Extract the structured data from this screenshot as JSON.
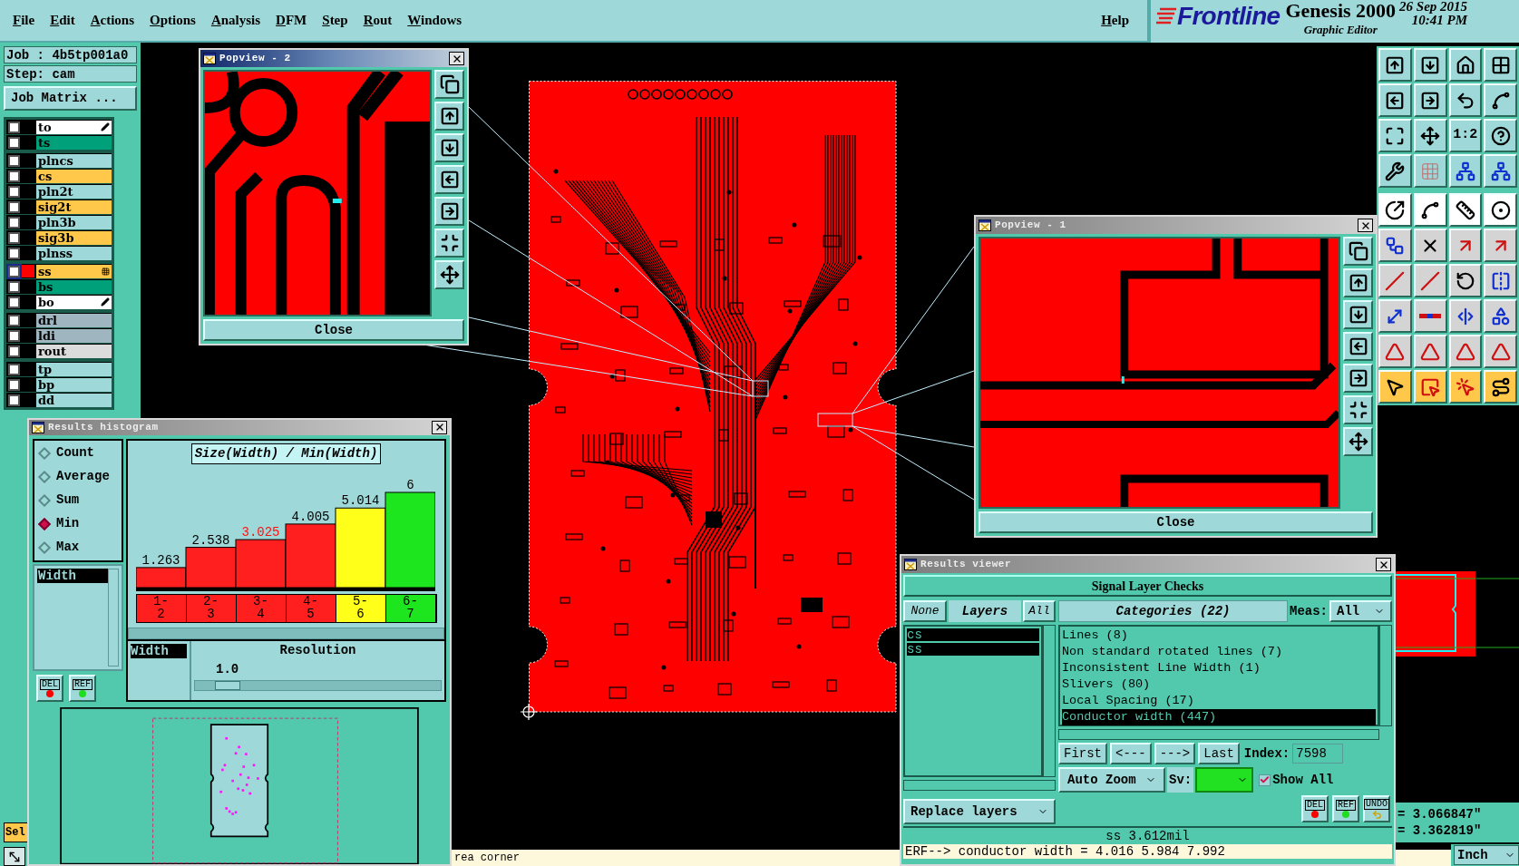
{
  "menu_bar": {
    "items": [
      "File",
      "Edit",
      "Actions",
      "Options",
      "Analysis",
      "DFM",
      "Step",
      "Rout",
      "Windows"
    ],
    "help": "Help"
  },
  "branding": {
    "logo": "Frontline",
    "product": "Genesis 2000",
    "subtitle": "Graphic Editor",
    "date": "26 Sep 2015",
    "time": "10:41 PM"
  },
  "job_panel": {
    "job": "Job : 4b5tp001a0",
    "step": "Step: cam",
    "job_matrix_button": "Job Matrix ...",
    "layer_groups": [
      {
        "layers": [
          {
            "name": "to",
            "color": "#ffffff",
            "checked": false,
            "work_layer": false,
            "pen_mark": true,
            "grid_mark": false
          },
          {
            "name": "ts",
            "color": "#00a07a",
            "checked": false,
            "work_layer": false,
            "pen_mark": false,
            "grid_mark": false
          }
        ]
      },
      {
        "layers": [
          {
            "name": "plncs",
            "color": "#9ed8d8",
            "checked": false,
            "work_layer": false,
            "pen_mark": false,
            "grid_mark": false
          },
          {
            "name": "cs",
            "color": "#ffc84a",
            "checked": false,
            "work_layer": false,
            "pen_mark": false,
            "grid_mark": false
          },
          {
            "name": "pln2t",
            "color": "#9ed8d8",
            "checked": false,
            "work_layer": false,
            "pen_mark": false,
            "grid_mark": false
          },
          {
            "name": "sig2t",
            "color": "#ffc84a",
            "checked": false,
            "work_layer": false,
            "pen_mark": false,
            "grid_mark": false
          },
          {
            "name": "pln3b",
            "color": "#9ed8d8",
            "checked": false,
            "work_layer": false,
            "pen_mark": false,
            "grid_mark": false
          },
          {
            "name": "sig3b",
            "color": "#ffc84a",
            "checked": false,
            "work_layer": false,
            "pen_mark": false,
            "grid_mark": false
          },
          {
            "name": "plnss",
            "color": "#9ed8d8",
            "checked": false,
            "work_layer": false,
            "pen_mark": false,
            "grid_mark": false
          }
        ]
      },
      {
        "layers": [
          {
            "name": "ss",
            "color": "#ffc84a",
            "checked": false,
            "work_layer": true,
            "pen_mark": false,
            "grid_mark": true
          },
          {
            "name": "bs",
            "color": "#00a07a",
            "checked": false,
            "work_layer": false,
            "pen_mark": false,
            "grid_mark": false
          },
          {
            "name": "bo",
            "color": "#ffffff",
            "checked": false,
            "work_layer": false,
            "pen_mark": true,
            "grid_mark": false
          }
        ]
      },
      {
        "layers": [
          {
            "name": "drl",
            "color": "#9fb6c0",
            "checked": false,
            "work_layer": false,
            "pen_mark": false,
            "grid_mark": false
          },
          {
            "name": "ldi",
            "color": "#9fb6c0",
            "checked": false,
            "work_layer": false,
            "pen_mark": false,
            "grid_mark": false
          },
          {
            "name": "rout",
            "color": "#dcdcdc",
            "checked": false,
            "work_layer": false,
            "pen_mark": false,
            "grid_mark": false
          }
        ]
      },
      {
        "layers": [
          {
            "name": "tp",
            "color": "#9ed8d8",
            "checked": false,
            "work_layer": false,
            "pen_mark": false,
            "grid_mark": false
          },
          {
            "name": "bp",
            "color": "#9ed8d8",
            "checked": false,
            "work_layer": false,
            "pen_mark": false,
            "grid_mark": false
          },
          {
            "name": "dd",
            "color": "#9ed8d8",
            "checked": false,
            "work_layer": false,
            "pen_mark": false,
            "grid_mark": false
          }
        ]
      }
    ]
  },
  "select_button": "Sel",
  "toolbar": {
    "ratio_label": "1:2"
  },
  "popviews": [
    {
      "title": "Popview - 2",
      "active": true,
      "close_button": "Close"
    },
    {
      "title": "Popview - 1",
      "active": false,
      "close_button": "Close"
    }
  ],
  "histogram": {
    "title": "Results histogram",
    "modes": [
      {
        "label": "Count",
        "selected": false
      },
      {
        "label": "Average",
        "selected": false
      },
      {
        "label": "Sum",
        "selected": false
      },
      {
        "label": "Min",
        "selected": true
      },
      {
        "label": "Max",
        "selected": false
      }
    ],
    "attributes": [
      {
        "label": "Width",
        "selected": true
      }
    ],
    "del_button": "DEL",
    "ref_button": "REF",
    "bins": [
      {
        "highlighted": false
      },
      {
        "highlighted": false
      },
      {
        "highlighted": true
      },
      {
        "highlighted": false
      },
      {
        "highlighted": false
      },
      {
        "highlighted": false
      }
    ],
    "chart_data": {
      "type": "bar",
      "title": "Size(Width) / Min(Width)",
      "categories": [
        "1-2",
        "2-3",
        "3-4",
        "4-5",
        "5-6",
        "6-7"
      ],
      "data_labels": true,
      "series": [
        {
          "color": "#ff1f1f",
          "values": [
            1.263,
            2.538,
            3.025,
            4.005,
            null,
            null
          ]
        },
        {
          "color": "#ffff1a",
          "values": [
            null,
            null,
            null,
            null,
            5.014,
            null
          ]
        },
        {
          "color": "#1ee61e",
          "values": [
            null,
            null,
            null,
            null,
            null,
            6
          ]
        }
      ]
    },
    "x_attributes": [
      {
        "label": "Width",
        "selected": true
      }
    ],
    "resolution": {
      "label": "Resolution",
      "value": "1.0",
      "level": 0.08
    }
  },
  "results_viewer": {
    "title": "Results viewer",
    "header": "Signal Layer Checks",
    "none_button": "None",
    "layers_label": "Layers",
    "all_button": "All",
    "layers": [
      {
        "name": "cs",
        "selected": true
      },
      {
        "name": "ss",
        "selected": true
      }
    ],
    "categories_label": "Categories (22)",
    "meas_label": "Meas:",
    "meas_value": "All",
    "categories": [
      {
        "label": "Lines (8)",
        "selected": false
      },
      {
        "label": "Non standard rotated lines (7)",
        "selected": false
      },
      {
        "label": "Inconsistent Line Width (1)",
        "selected": false
      },
      {
        "label": "Slivers (80)",
        "selected": false
      },
      {
        "label": "Local Spacing (17)",
        "selected": false
      },
      {
        "label": "Conductor width (447)",
        "selected": true
      }
    ],
    "nav_buttons": [
      "First",
      "<---",
      "--->",
      "Last"
    ],
    "index_label": "Index:",
    "index_value": "7598",
    "zoom_mode": "Auto Zoom",
    "sv_label": "Sv:",
    "show_all": {
      "label": "Show All",
      "checked": true
    },
    "replace_layers": "Replace layers",
    "del_button": "DEL",
    "ref_button": "REF",
    "undo_button": "UNDO",
    "measurement": "ss 3.612mil",
    "erf_line": "ERF--> conductor width = 4.016 5.984 7.992"
  },
  "coordinates": {
    "x": "= 3.066847\"",
    "y": "= 3.362819\"",
    "units": "Inch"
  },
  "status_bar": {
    "message": "rea corner"
  }
}
